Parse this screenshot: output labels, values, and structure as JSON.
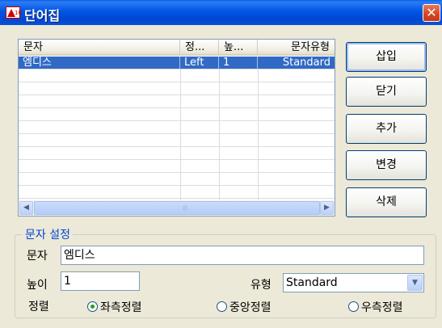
{
  "window": {
    "title": "단어집",
    "close_glyph": "✕"
  },
  "list": {
    "columns": [
      "문자",
      "정...",
      "높...",
      "문자유형"
    ],
    "rows": [
      {
        "text": "엠디스",
        "align": "Left",
        "height": "1",
        "style": "Standard",
        "selected": true
      }
    ],
    "scroll_left": "◀",
    "scroll_right": "▶",
    "scroll_grip": "|||"
  },
  "buttons": {
    "insert": "삽입",
    "close": "닫기",
    "add": "추가",
    "modify": "변경",
    "delete": "삭제"
  },
  "settings": {
    "title": "문자 설정",
    "text_label": "문자",
    "text_value": "엠디스",
    "height_label": "높이",
    "height_value": "1",
    "style_label": "유형",
    "style_value": "Standard",
    "combo_arrow": "▼",
    "align_label": "정렬",
    "align_options": [
      "좌측정렬",
      "중앙정렬",
      "우측정렬"
    ],
    "align_selected": "좌측정렬"
  }
}
